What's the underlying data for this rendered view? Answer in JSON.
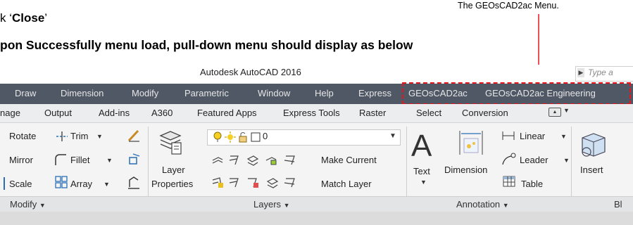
{
  "instructions": {
    "step_prefix": "k ‘",
    "step_bold": "Close",
    "step_suffix": "’",
    "note": "pon Successfully menu load, pull-down menu should display as below",
    "callout": "The GEOsCAD2ac Menu."
  },
  "window": {
    "title": "Autodesk AutoCAD 2016",
    "search_placeholder": "Type a "
  },
  "menubar": {
    "items": [
      "Draw",
      "Dimension",
      "Modify",
      "Parametric",
      "Window",
      "Help",
      "Express",
      "GEOsCAD2ac",
      "GEOsCAD2ac Engineering"
    ]
  },
  "ribbon_tabs": [
    "nage",
    "Output",
    "Add-ins",
    "A360",
    "Featured Apps",
    "Express Tools",
    "Raster",
    "Select",
    "Conversion"
  ],
  "modify_panel": {
    "rotate": "Rotate",
    "trim": "Trim",
    "mirror": "Mirror",
    "fillet": "Fillet",
    "scale": "Scale",
    "array": "Array",
    "title": "Modify"
  },
  "layers_panel": {
    "layer_properties_line1": "Layer",
    "layer_properties_line2": "Properties",
    "current_layer": "0",
    "make_current": "Make Current",
    "match_layer": "Match Layer",
    "title": "Layers"
  },
  "annotation_panel": {
    "text": "Text",
    "dimension": "Dimension",
    "linear": "Linear",
    "leader": "Leader",
    "table": "Table",
    "title": "Annotation"
  },
  "block_panel": {
    "insert": "Insert",
    "title_partial": "Bl"
  },
  "colors": {
    "menubar_bg": "#505866",
    "highlight_dash": "#e8141c"
  }
}
